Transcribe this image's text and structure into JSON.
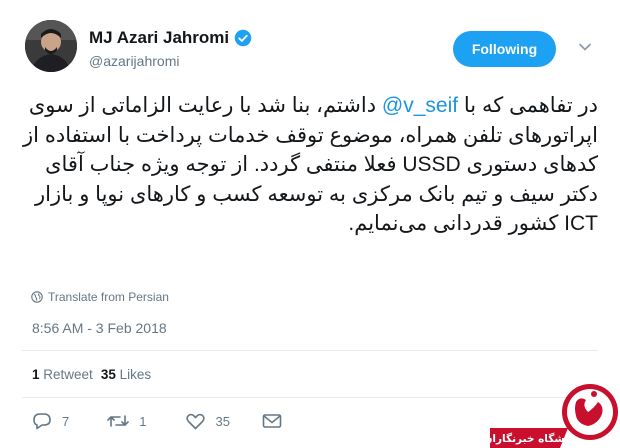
{
  "user": {
    "name": "MJ Azari Jahromi",
    "handle": "@azarijahromi"
  },
  "follow_button": "Following",
  "tweet": {
    "before_mention": "در تفاهمی که با ",
    "mention": "@v_seif",
    "after_mention": " داشتم، بنا شد با رعایت الزاماتی از سوی اپراتورهای تلفن همراه، موضوع توقف خدمات پرداخت با استفاده از کدهای دستوری USSD فعلا منتفی گردد. از توجه ویژه جناب آقای دکتر سیف و تیم بانک مرکزی به توسعه کسب و کارهای نوپا و بازار ICT کشور قدردانی می‌نمایم."
  },
  "translate_label": "Translate from Persian",
  "timestamp": "8:56 AM - 3 Feb 2018",
  "stats": {
    "retweets_count": "1",
    "retweets_label": "Retweet",
    "likes_count": "35",
    "likes_label": "Likes"
  },
  "actions": {
    "reply_count": "7",
    "retweet_count": "1",
    "like_count": "35"
  },
  "watermark": {
    "text": "باشگاه خبرنگاران",
    "colors": {
      "red": "#c8102e",
      "white": "#ffffff"
    }
  },
  "colors": {
    "accent": "#1da1f2",
    "link": "#1b95e0",
    "muted": "#657786",
    "text": "#14171a"
  }
}
